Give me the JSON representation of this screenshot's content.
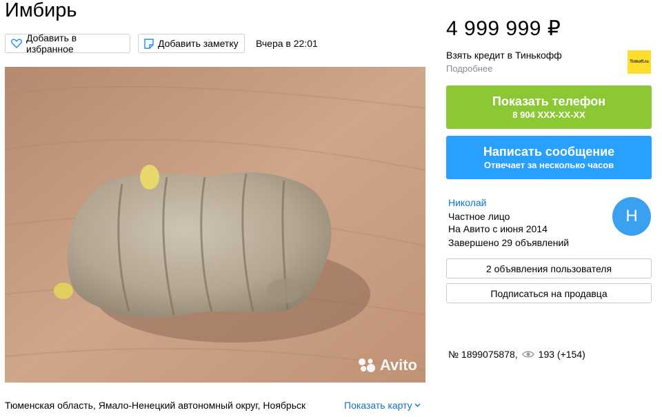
{
  "listing": {
    "title": "Имбирь",
    "favorite_label": "Добавить в избранное",
    "note_label": "Добавить заметку",
    "posted": "Вчера в 22:01",
    "watermark": "Avito",
    "location": "Тюменская область, Ямало-Ненецкий автономный округ, Ноябрьск",
    "show_map": "Показать карту"
  },
  "sidebar": {
    "price": "4 999 999 ₽",
    "credit_text": "Взять кредит в Тинькофф",
    "credit_more": "Подробнее",
    "tinkoff_logo": "Tinkoff.ru",
    "phone_button": {
      "label": "Показать телефон",
      "number": "8 904 XXX-XX-XX"
    },
    "message_button": {
      "label": "Написать сообщение",
      "sub": "Отвечает за несколько часов"
    },
    "seller": {
      "name": "Николай",
      "type": "Частное лицо",
      "since": "На Авито с июня 2014",
      "completed": "Завершено 29 объявлений",
      "avatar_letter": "Н"
    },
    "user_ads_button": "2 объявления пользователя",
    "subscribe_button": "Подписаться на продавца",
    "ad_number": "№ 1899075878,",
    "views": "193 (+154)"
  },
  "colors": {
    "green_button": "#8bc834",
    "blue_button": "#27a0ff",
    "link": "#0a72cc",
    "avatar": "#3aa0f0"
  }
}
